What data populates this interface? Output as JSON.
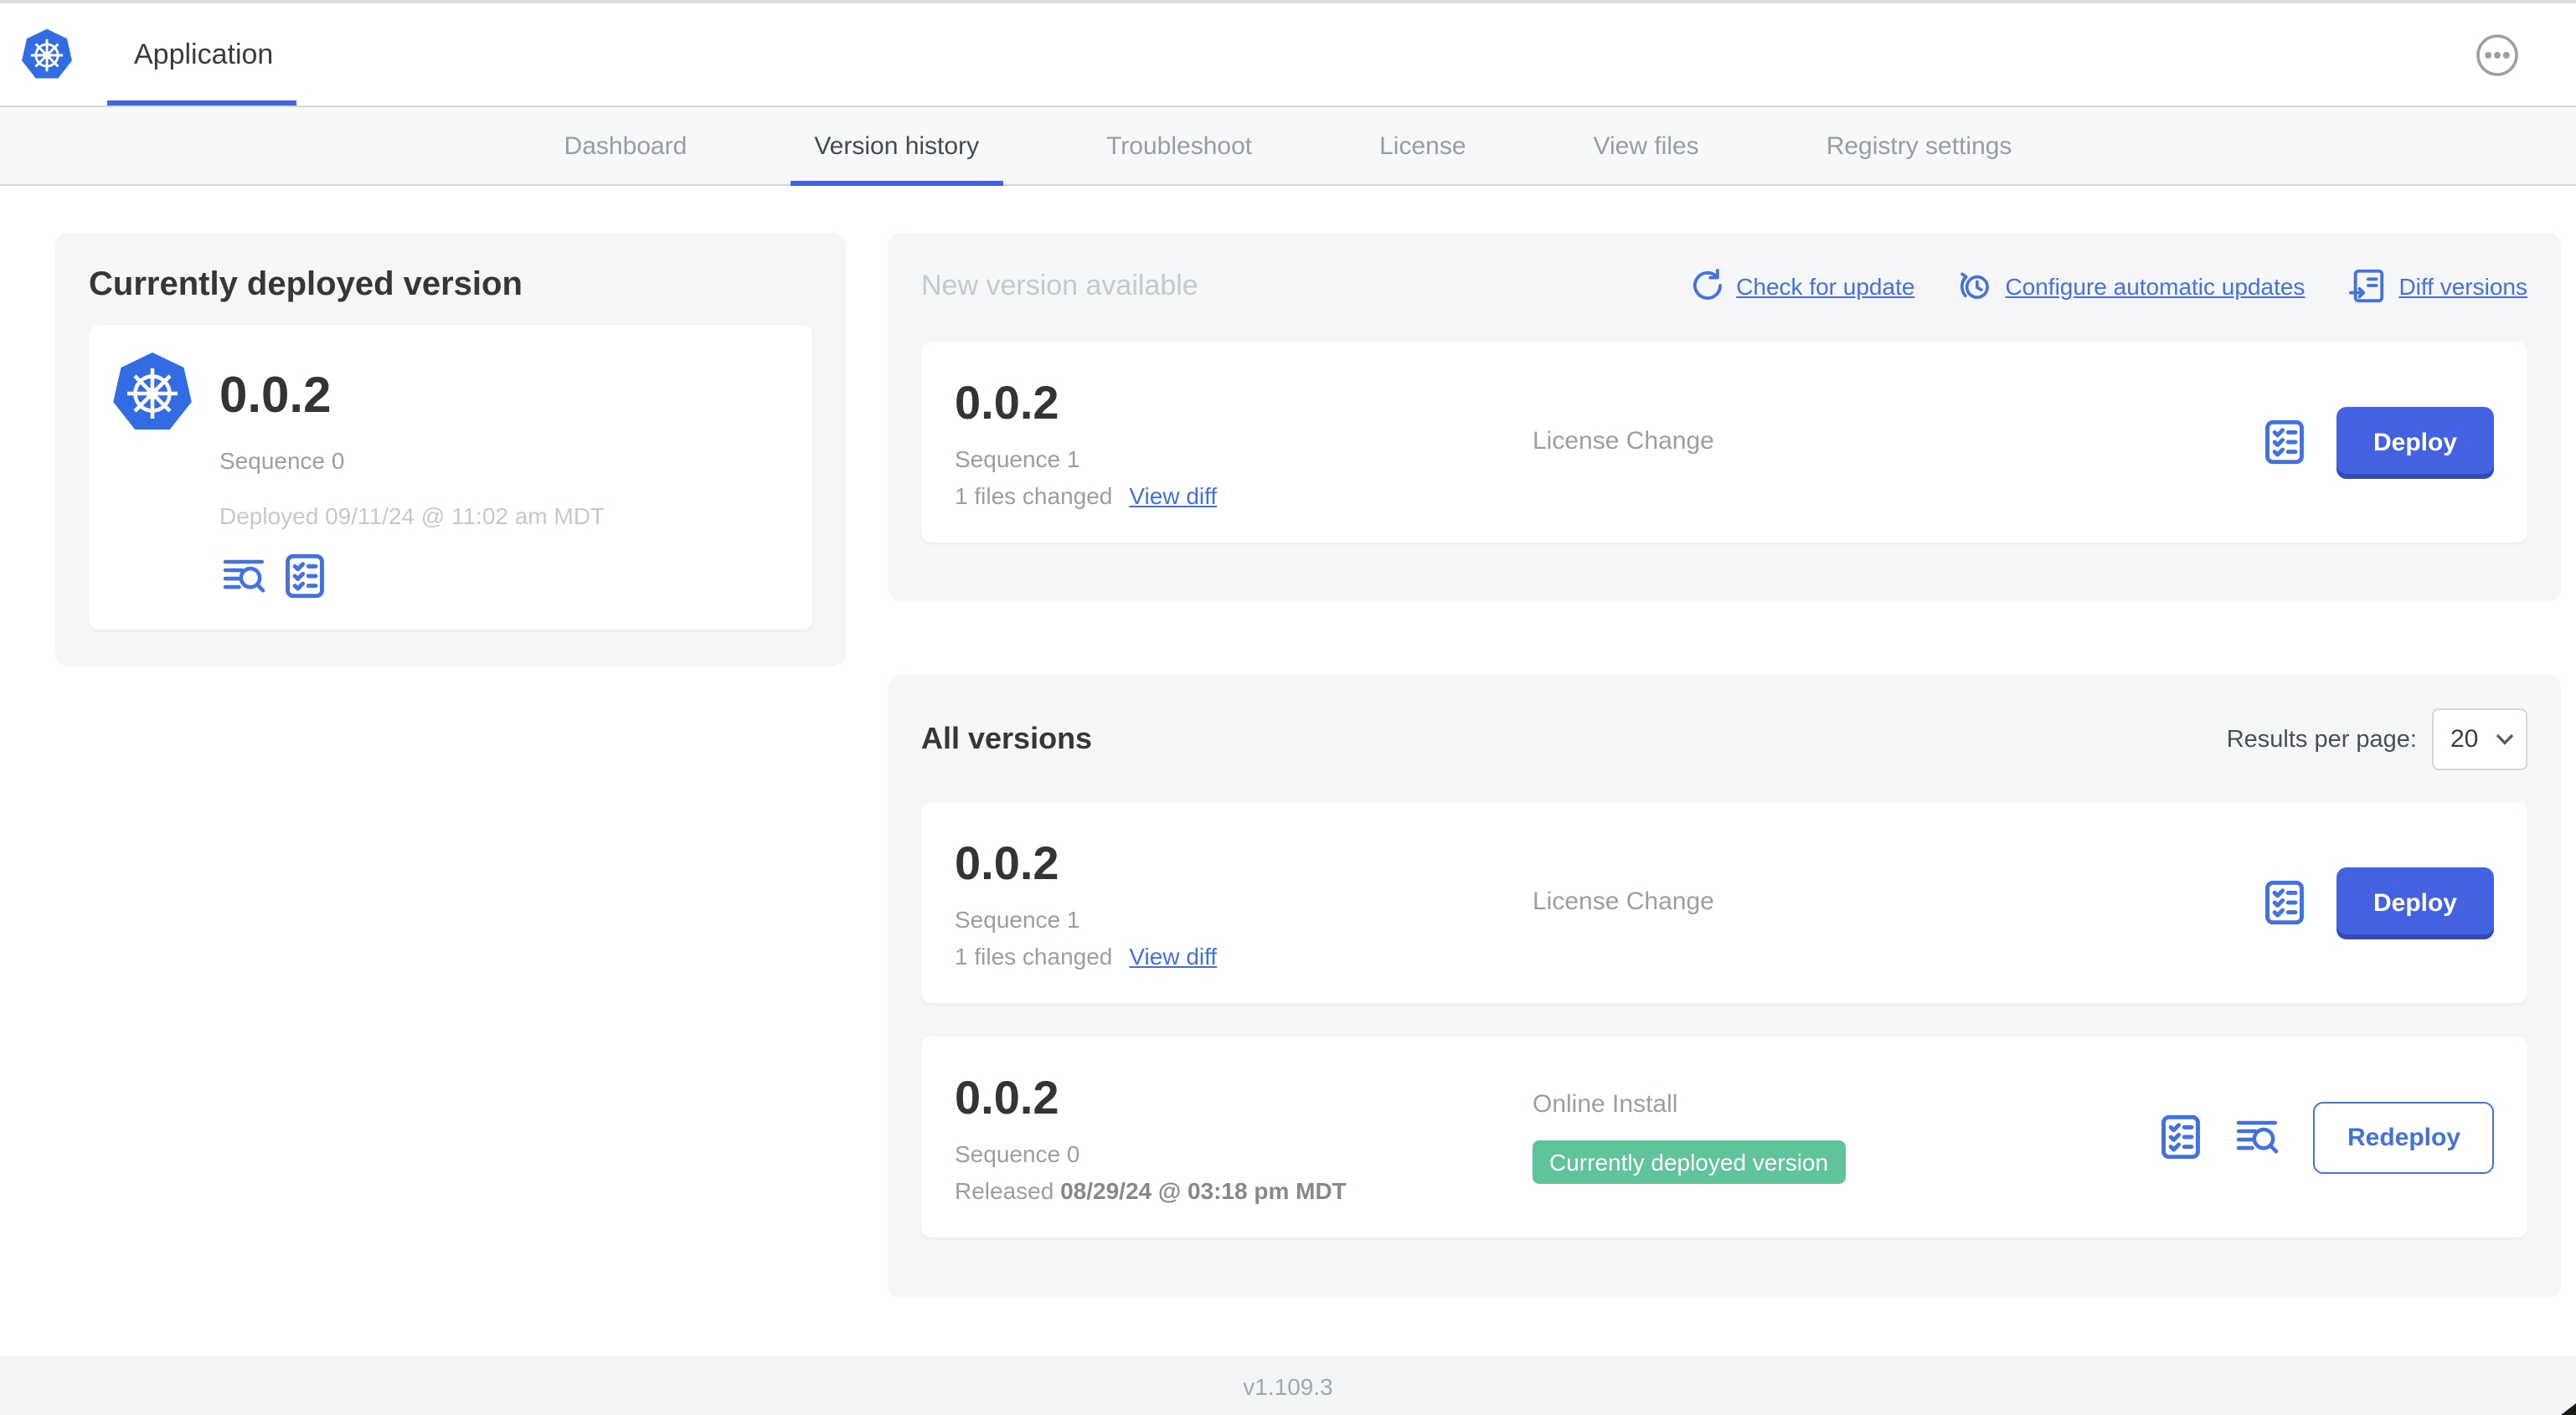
{
  "colors": {
    "accent_blue": "#4262E2",
    "link_blue": "#4471E0",
    "k8s_blue": "#326CE5",
    "badge_green": "#61C39A"
  },
  "header": {
    "app_title": "Application"
  },
  "nav": {
    "active_tab": "Version history",
    "tabs": [
      {
        "label": "Dashboard"
      },
      {
        "label": "Version history"
      },
      {
        "label": "Troubleshoot"
      },
      {
        "label": "License"
      },
      {
        "label": "View files"
      },
      {
        "label": "Registry settings"
      }
    ]
  },
  "current_version_panel": {
    "title": "Currently deployed version",
    "version": "0.0.2",
    "sequence": "Sequence 0",
    "deployed_timestamp": "Deployed 09/11/24 @ 11:02 am MDT"
  },
  "new_version_panel": {
    "title": "New version available",
    "actions": {
      "check_for_update": "Check for update",
      "configure_automatic_updates": "Configure automatic updates",
      "diff_versions": "Diff versions"
    },
    "row": {
      "version": "0.0.2",
      "sequence": "Sequence 1",
      "files_changed": "1 files changed",
      "view_diff_label": "View diff",
      "source": "License Change",
      "deploy_label": "Deploy"
    }
  },
  "all_versions_panel": {
    "title": "All versions",
    "results_per_page_label": "Results per page:",
    "results_per_page_value": "20",
    "rows": [
      {
        "version": "0.0.2",
        "sequence": "Sequence 1",
        "files_changed": "1 files changed",
        "view_diff_label": "View diff",
        "source": "License Change",
        "action_label": "Deploy"
      },
      {
        "version": "0.0.2",
        "sequence": "Sequence 0",
        "released_prefix": "Released ",
        "released_date": "08/29/24 @ 03:18 pm MDT",
        "source": "Online Install",
        "badge": "Currently deployed version",
        "action_label": "Redeploy"
      }
    ]
  },
  "footer": {
    "app_version": "v1.109.3"
  }
}
